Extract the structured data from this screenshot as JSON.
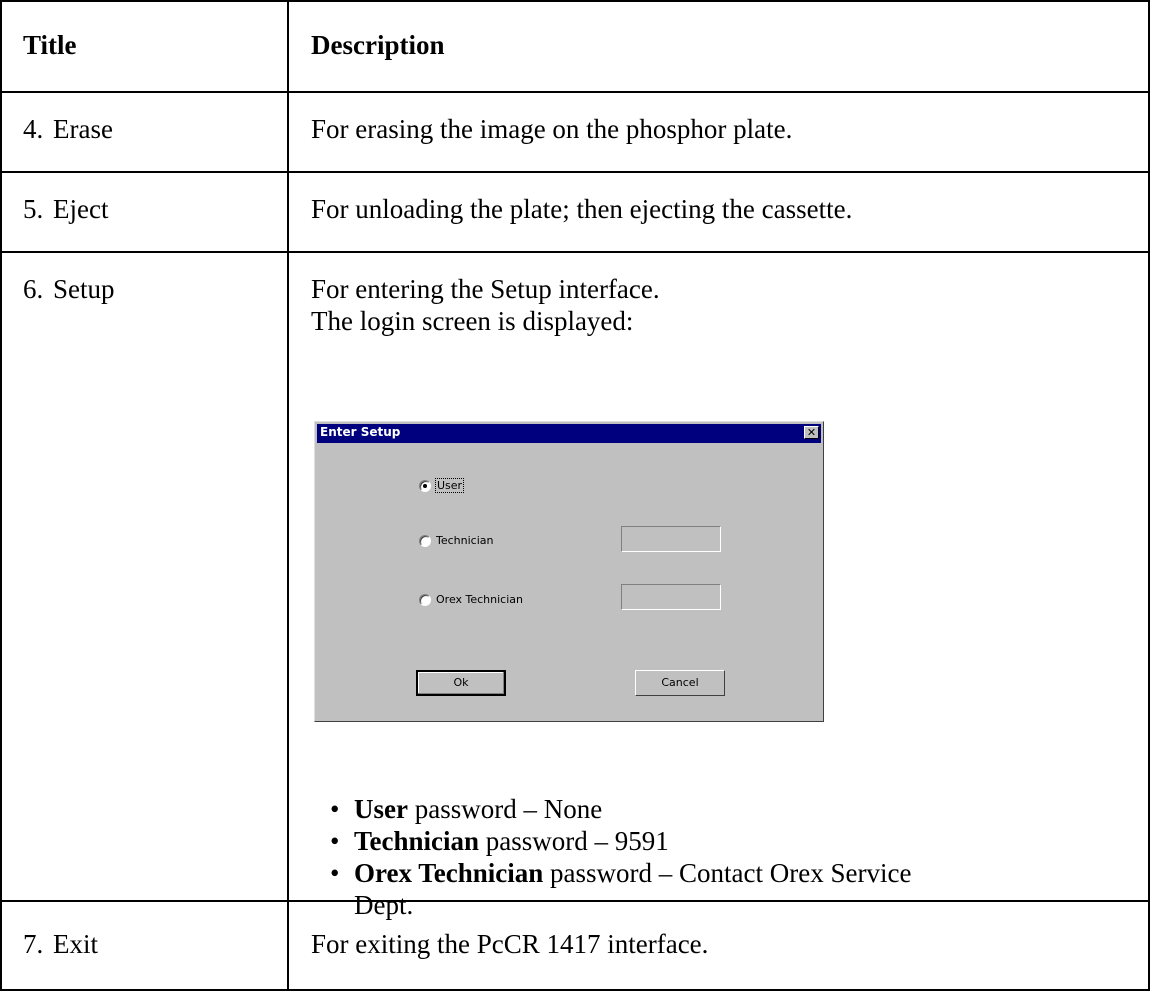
{
  "table": {
    "header": {
      "title": "Title",
      "description": "Description"
    },
    "rows": [
      {
        "num": "4.",
        "title": "Erase",
        "description": "For erasing the image on the phosphor plate."
      },
      {
        "num": "5.",
        "title": "Eject",
        "description": "For unloading the plate; then ejecting the cassette."
      },
      {
        "num": "6.",
        "title": "Setup",
        "description_line1": "For entering the Setup interface.",
        "description_line2": "The login screen is displayed:"
      },
      {
        "num": "7.",
        "title": "Exit",
        "description": "For exiting the PcCR 1417 interface."
      }
    ]
  },
  "dialog": {
    "title": "Enter Setup",
    "close_glyph": "✕",
    "options": [
      {
        "label": "User",
        "checked": true
      },
      {
        "label": "Technician",
        "checked": false
      },
      {
        "label": "Orex Technician",
        "checked": false
      }
    ],
    "ok_label": "Ok",
    "cancel_label": "Cancel"
  },
  "passwords": [
    {
      "role": "User",
      "text": " password – None"
    },
    {
      "role": "Technician",
      "text": " password – 9591"
    },
    {
      "role": "Orex Technician",
      "text": " password – Contact Orex Service",
      "continuation": "Dept."
    }
  ]
}
